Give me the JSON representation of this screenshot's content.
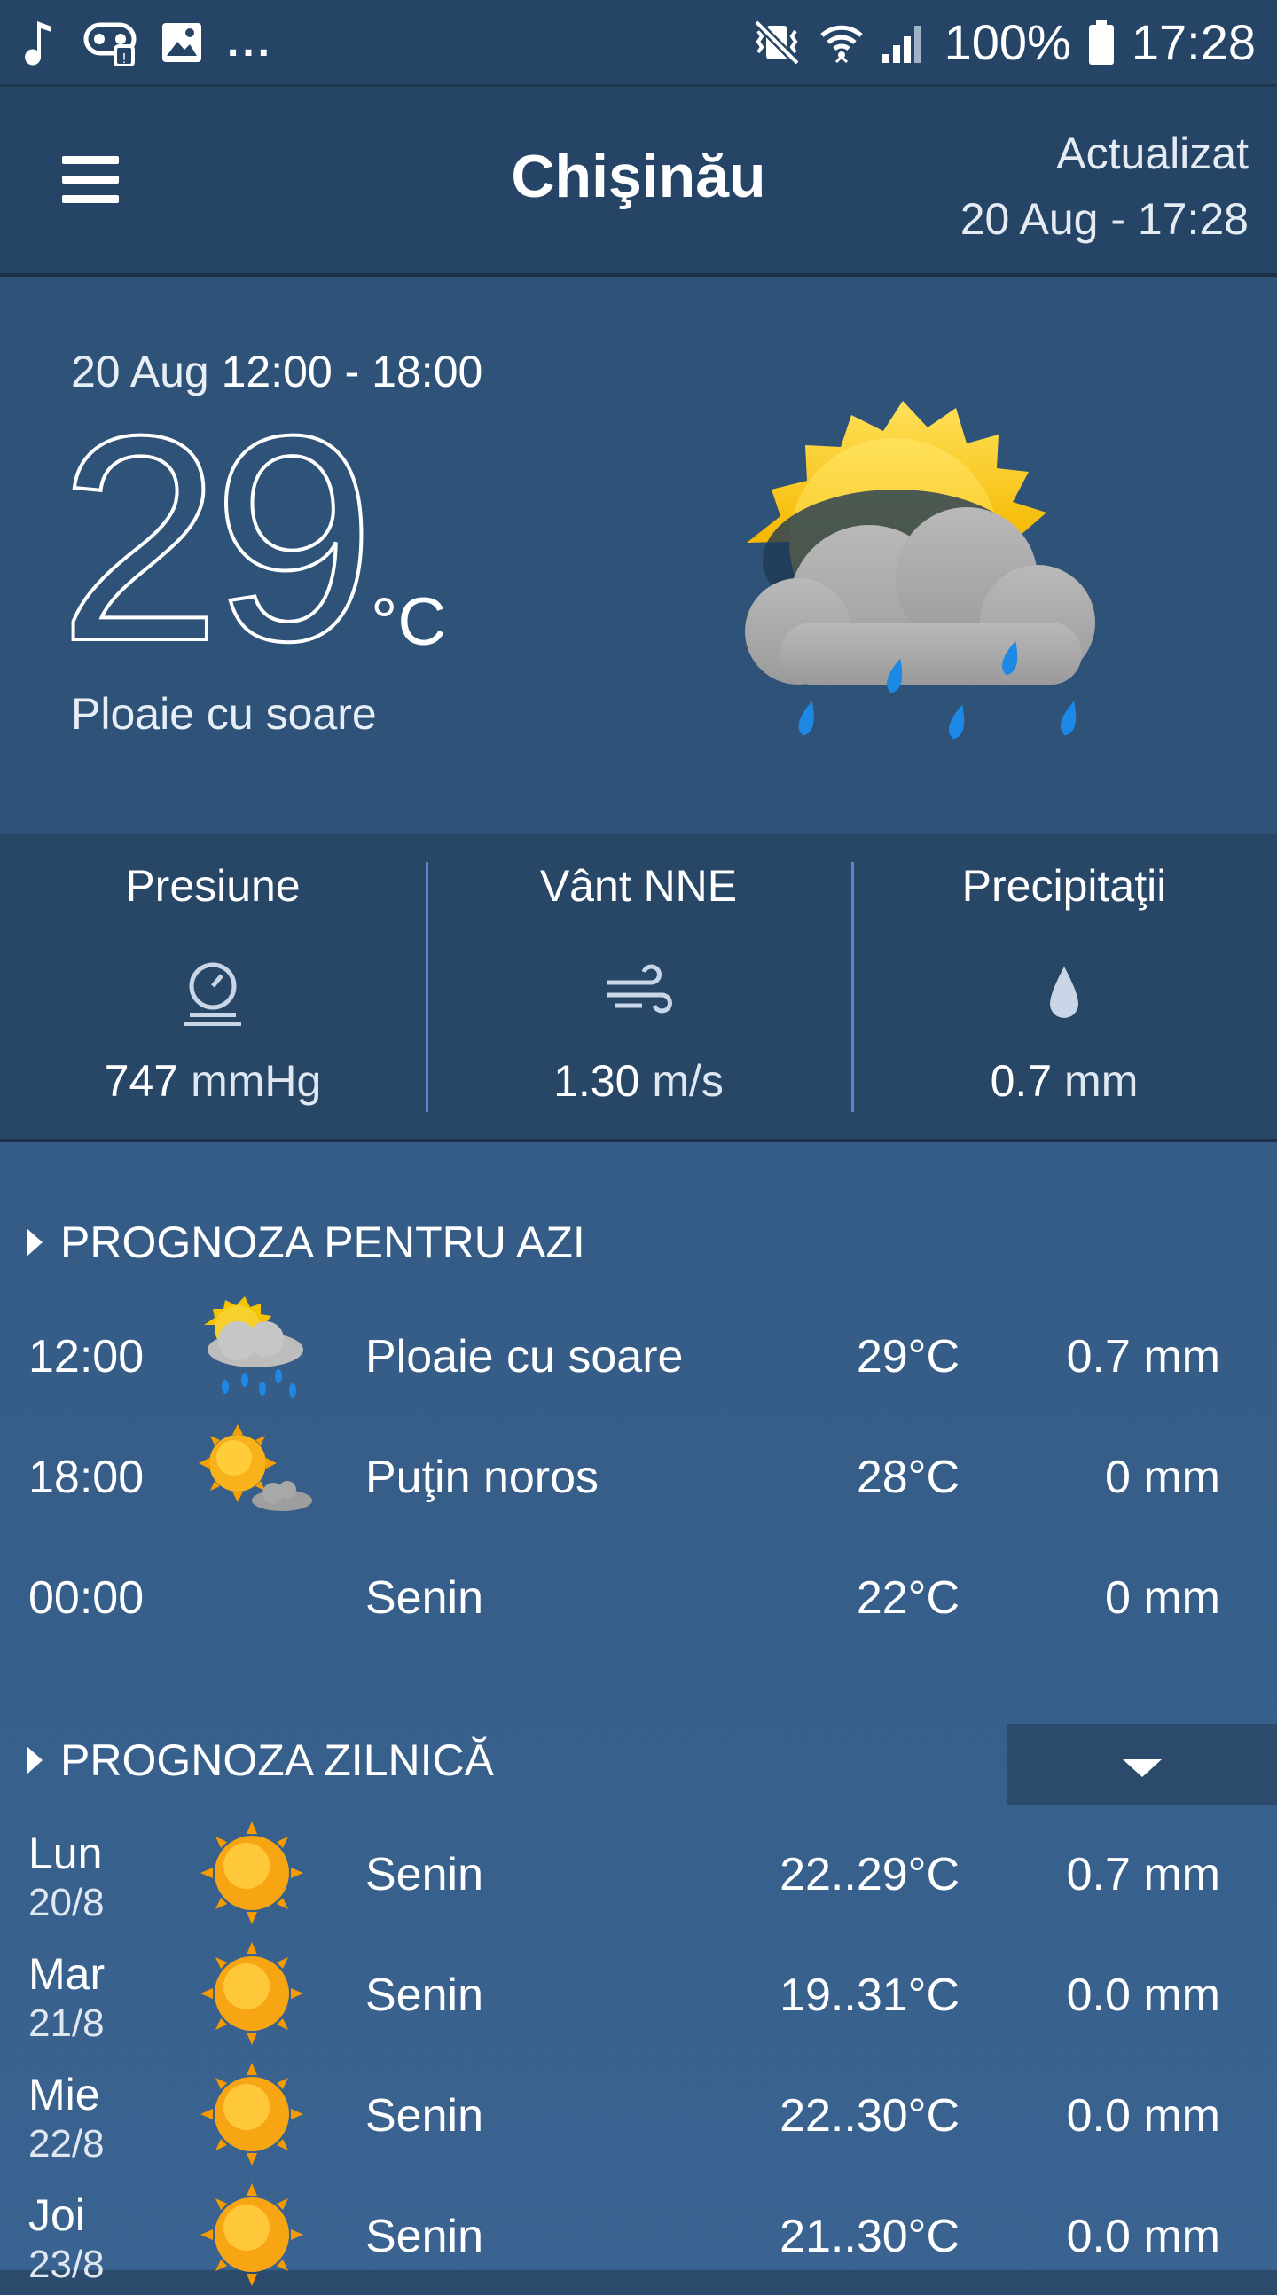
{
  "status_bar": {
    "icons_left": [
      "music-note-icon",
      "voicemail-alert-icon",
      "image-icon"
    ],
    "more": "...",
    "icons_right": [
      "vibrate-mute-icon",
      "wifi-icon",
      "signal-icon"
    ],
    "battery": "100%",
    "time": "17:28"
  },
  "header": {
    "city": "Chişinău",
    "updated_label": "Actualizat",
    "updated_time": "20 Aug - 17:28"
  },
  "current": {
    "date": "20 Aug",
    "period": "12:00 - 18:00",
    "temperature": "29",
    "unit": "°C",
    "description": "Ploaie cu soare",
    "icon": "sun-cloud-rain-icon"
  },
  "stats": [
    {
      "label": "Presiune",
      "icon": "pressure-gauge-icon",
      "value": "747",
      "unit": "mmHg"
    },
    {
      "label": "Vânt NNE",
      "icon": "wind-icon",
      "value": "1.30",
      "unit": "m/s"
    },
    {
      "label": "Precipitaţii",
      "icon": "drop-icon",
      "value": "0.7",
      "unit": "mm"
    }
  ],
  "today": {
    "title": "PROGNOZA PENTRU AZI",
    "rows": [
      {
        "time": "12:00",
        "icon": "sun-cloud-rain-icon",
        "desc": "Ploaie cu soare",
        "temp": "29°C",
        "precip": "0.7 mm"
      },
      {
        "time": "18:00",
        "icon": "sun-small-cloud-icon",
        "desc": "Puţin noros",
        "temp": "28°C",
        "precip": "0 mm"
      },
      {
        "time": "00:00",
        "icon": "moon-icon",
        "desc": "Senin",
        "temp": "22°C",
        "precip": "0 mm"
      }
    ]
  },
  "daily": {
    "title": "PROGNOZA ZILNICĂ",
    "rows": [
      {
        "day": "Lun",
        "date": "20/8",
        "icon": "sun-icon",
        "desc": "Senin",
        "temp": "22..29°C",
        "precip": "0.7 mm"
      },
      {
        "day": "Mar",
        "date": "21/8",
        "icon": "sun-icon",
        "desc": "Senin",
        "temp": "19..31°C",
        "precip": "0.0 mm"
      },
      {
        "day": "Mie",
        "date": "22/8",
        "icon": "sun-icon",
        "desc": "Senin",
        "temp": "22..30°C",
        "precip": "0.0 mm"
      },
      {
        "day": "Joi",
        "date": "23/8",
        "icon": "sun-icon",
        "desc": "Senin",
        "temp": "21..30°C",
        "precip": "0.0 mm"
      }
    ]
  },
  "colors": {
    "background_top": "#2b4a6c",
    "background_bottom": "#3a6391",
    "divider": "#5b86c8",
    "sun": "#f6a623",
    "rain": "#1e88e5"
  }
}
